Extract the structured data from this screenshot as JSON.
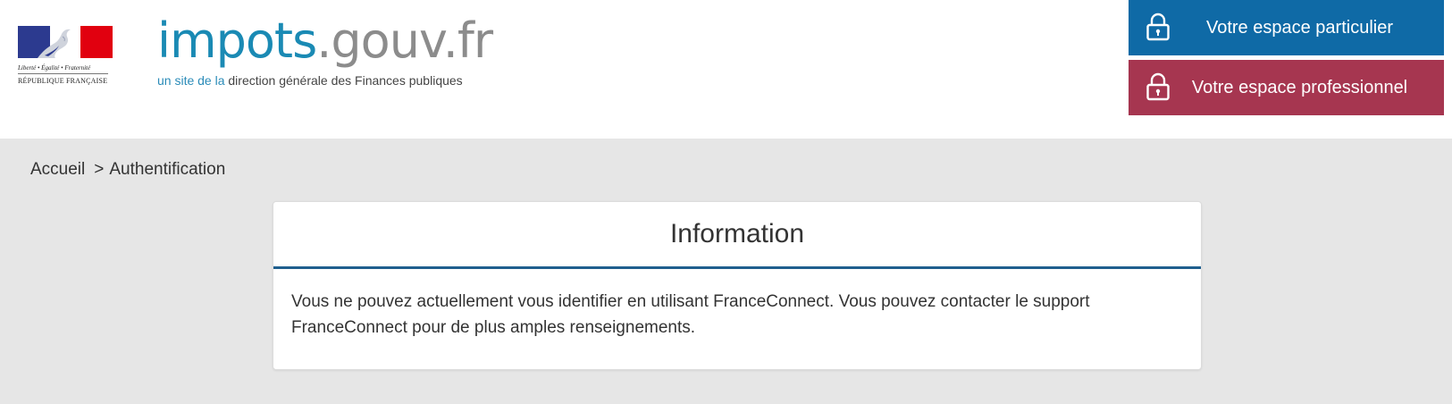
{
  "header": {
    "republic_logo": {
      "motto": "Liberté • Égalité • Fraternité",
      "name": "RÉPUBLIQUE FRANÇAISE"
    },
    "site_logo": {
      "title_part1": "impots",
      "title_part2": ".gouv.fr",
      "tagline_part1": "un site de la",
      "tagline_part2": "direction générale des Finances publiques"
    },
    "buttons": {
      "particulier_label": "Votre espace particulier",
      "professionnel_label": "Votre espace professionnel"
    }
  },
  "breadcrumb": {
    "home": "Accueil",
    "separator": ">",
    "current": "Authentification"
  },
  "card": {
    "title": "Information",
    "message": "Vous ne pouvez actuellement vous identifier en utilisant FranceConnect. Vous pouvez contacter le support FranceConnect pour de plus amples renseignements."
  },
  "icons": {
    "particulier": "lock-icon",
    "professionnel": "lock-icon"
  },
  "colors": {
    "particulier_button": "#0f6aa6",
    "professionnel_button": "#a63650",
    "brand_blue": "#1a8ab4",
    "card_accent": "#1f5f8e",
    "page_background": "#e6e6e6"
  }
}
